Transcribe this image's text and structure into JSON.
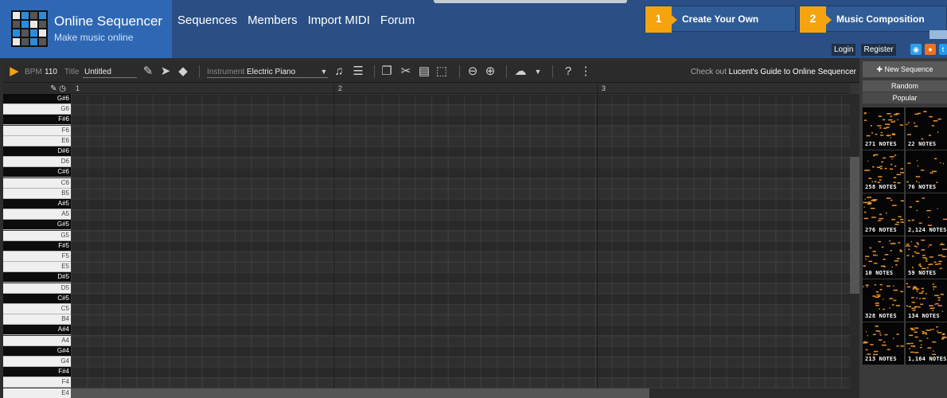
{
  "brand": {
    "name": "Online Sequencer",
    "subtitle": "Make music online"
  },
  "nav": [
    "Sequences",
    "Members",
    "Import MIDI",
    "Forum"
  ],
  "promos": [
    {
      "num": "1",
      "label": "Create Your Own"
    },
    {
      "num": "2",
      "label": "Music Composition"
    }
  ],
  "account": {
    "login": "Login",
    "register": "Register"
  },
  "toolbar": {
    "bpm_label": "BPM",
    "bpm_value": "110",
    "title_label": "Title",
    "title_value": "Untitled",
    "instrument_label": "Instrument",
    "instrument_value": "Electric Piano",
    "guide_prefix": "Check out ",
    "guide_link": "Lucent's Guide to Online Sequencer"
  },
  "ruler": {
    "bars": [
      "1",
      "2",
      "3"
    ]
  },
  "keys": [
    "G#6",
    "G6",
    "F#6",
    "F6",
    "E6",
    "D#6",
    "D6",
    "C#6",
    "C6",
    "B5",
    "A#5",
    "A5",
    "G#5",
    "G5",
    "F#5",
    "F5",
    "E5",
    "D#5",
    "D5",
    "C#5",
    "C5",
    "B4",
    "A#4",
    "A4",
    "G#4",
    "G4",
    "F#4",
    "F4",
    "E4"
  ],
  "sidebar": {
    "new_sequence": "New Sequence",
    "random": "Random",
    "popular": "Popular",
    "sequences": [
      {
        "notes": "271 NOTES"
      },
      {
        "notes": "22 NOTES"
      },
      {
        "notes": "258 NOTES"
      },
      {
        "notes": "76 NOTES"
      },
      {
        "notes": "276 NOTES"
      },
      {
        "notes": "2,124 NOTES"
      },
      {
        "notes": "10 NOTES"
      },
      {
        "notes": "59 NOTES"
      },
      {
        "notes": "328 NOTES"
      },
      {
        "notes": "134 NOTES"
      },
      {
        "notes": "213 NOTES"
      },
      {
        "notes": "1,164 NOTES"
      }
    ]
  },
  "colors": {
    "accent": "#f5a40f",
    "header": "#2b4f84",
    "brand": "#2e68b5",
    "note": "#e8922a"
  }
}
